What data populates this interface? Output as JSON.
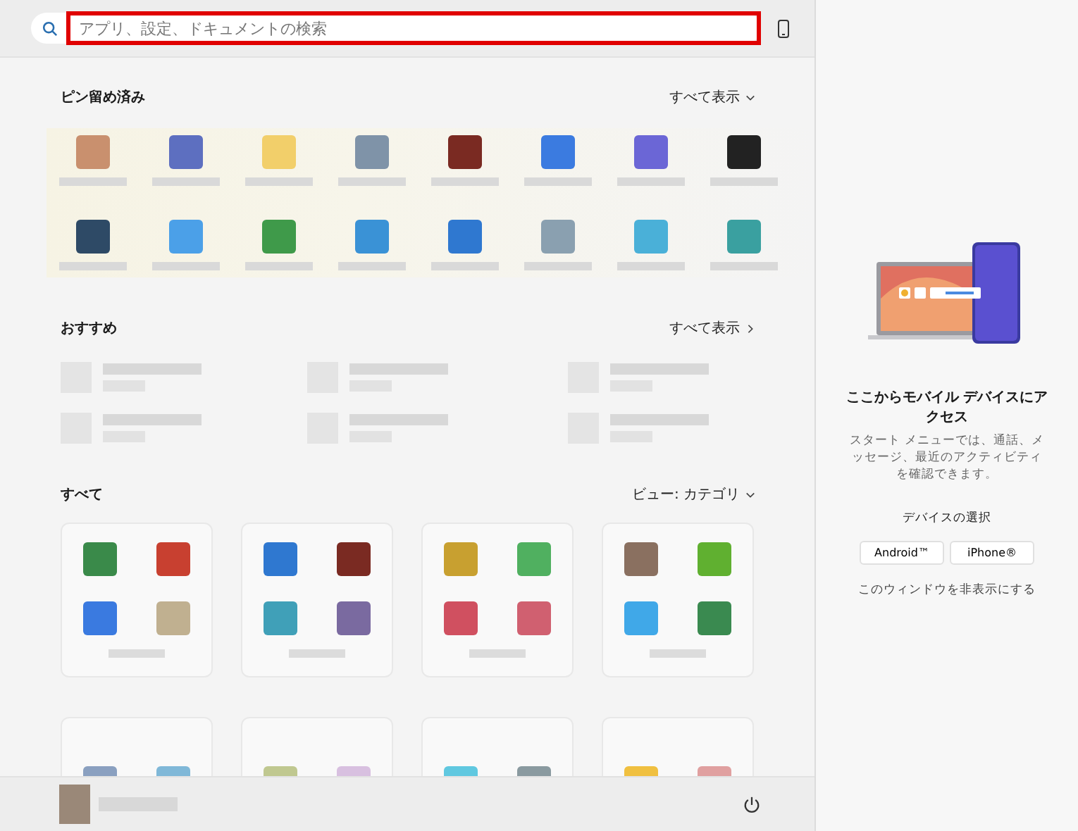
{
  "search": {
    "placeholder": "アプリ、設定、ドキュメントの検索",
    "highlighted": true
  },
  "pinned": {
    "title": "ピン留め済み",
    "action": "すべて表示",
    "apps": [
      {
        "color": "#c9906e"
      },
      {
        "color": "#5d6fc0"
      },
      {
        "color": "#f2cf6a"
      },
      {
        "color": "#7f93a8"
      },
      {
        "color": "#7a2a22"
      },
      {
        "color": "#3b7be0"
      },
      {
        "color": "#6b66d6"
      },
      {
        "color": "#222222"
      },
      {
        "color": "#2e4a66"
      },
      {
        "color": "#4ba0e8"
      },
      {
        "color": "#3f9a4a"
      },
      {
        "color": "#3a92d6"
      },
      {
        "color": "#2f78d0"
      },
      {
        "color": "#8aa0b0"
      },
      {
        "color": "#4ab0d8"
      },
      {
        "color": "#3aa0a0"
      }
    ]
  },
  "recommended": {
    "title": "おすすめ",
    "action": "すべて表示",
    "items": [
      {
        "kind": "redacted"
      },
      {
        "kind": "redacted"
      },
      {
        "kind": "redacted"
      },
      {
        "kind": "redacted"
      },
      {
        "kind": "redacted"
      },
      {
        "kind": "redacted"
      }
    ]
  },
  "all": {
    "title": "すべて",
    "view": "ビュー: カテゴリ",
    "categories": [
      {
        "icons": [
          {
            "color": "#3a8a4a"
          },
          {
            "color": "#c84030"
          },
          {
            "color": "#3a7ae0"
          },
          {
            "color": "#c0b090"
          }
        ]
      },
      {
        "icons": [
          {
            "color": "#2f78d0"
          },
          {
            "color": "#7a2a22"
          },
          {
            "color": "#40a0b8"
          },
          {
            "color": "#7a6aa0"
          }
        ]
      },
      {
        "icons": [
          {
            "color": "#c8a030"
          },
          {
            "color": "#50b060"
          },
          {
            "color": "#d05060"
          },
          {
            "color": "#d06070"
          }
        ]
      },
      {
        "icons": [
          {
            "color": "#8a7060"
          },
          {
            "color": "#60b030"
          },
          {
            "color": "#40a8e8"
          },
          {
            "color": "#3a8a50"
          }
        ]
      },
      {
        "icons": [
          {
            "color": "#8aa0c0"
          },
          {
            "color": "#80b8d8"
          }
        ]
      },
      {
        "icons": [
          {
            "color": "#c0c890"
          },
          {
            "color": "#d8c0e0"
          }
        ]
      },
      {
        "icons": [
          {
            "color": "#60c8e0"
          },
          {
            "color": "#8a9aa0"
          }
        ]
      },
      {
        "icons": [
          {
            "color": "#f0c040"
          },
          {
            "color": "#e0a0a0"
          }
        ]
      }
    ]
  },
  "user": {
    "kind": "redacted"
  },
  "phone_panel": {
    "title": "ここからモバイル デバイスにアクセス",
    "description": "スタート メニューでは、通話、メッセージ、最近のアクティビティを確認できます。",
    "select_label": "デバイスの選択",
    "buttons": [
      "Android™",
      "iPhone®"
    ],
    "hide_link": "このウィンドウを非表示にする"
  }
}
